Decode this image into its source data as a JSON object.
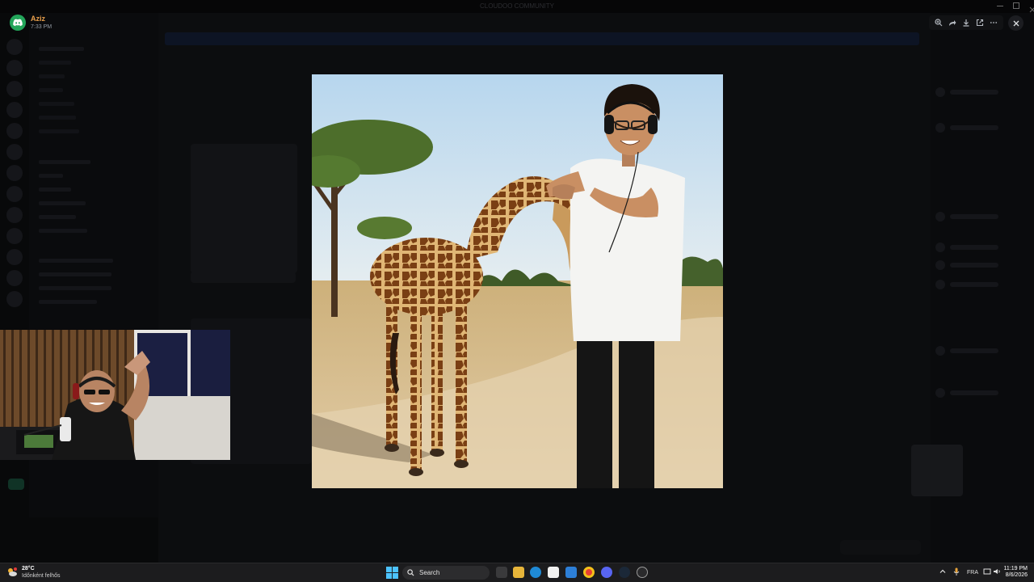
{
  "window": {
    "title": "CLOUDOO COMMUNITY"
  },
  "sender": {
    "name": "Aziz",
    "time": "7:33 PM"
  },
  "viewer": {
    "tools": [
      "zoom-in-icon",
      "share-icon",
      "download-icon",
      "open-external-icon",
      "more-icon"
    ],
    "close_icon": "close-icon"
  },
  "image": {
    "description_icon": "image-viewer",
    "colors": {
      "sky": "#c6dff0",
      "ground": "#d8c29a",
      "shirt": "#f4f4f2",
      "pants": "#121212",
      "giraffe": "#b9863f"
    }
  },
  "taskbar": {
    "weather": {
      "temp": "28°C",
      "desc": "Időnként felhős"
    },
    "search_label": "Search",
    "apps": [
      "task-view-icon",
      "file-explorer-icon",
      "edge-icon",
      "store-icon",
      "mail-icon",
      "chrome-icon",
      "discord-icon",
      "steam-icon",
      "app-icon"
    ],
    "tray": {
      "lang": "FRA"
    },
    "clock": {
      "time": "11:19 PM",
      "date": "8/6/2026"
    }
  }
}
